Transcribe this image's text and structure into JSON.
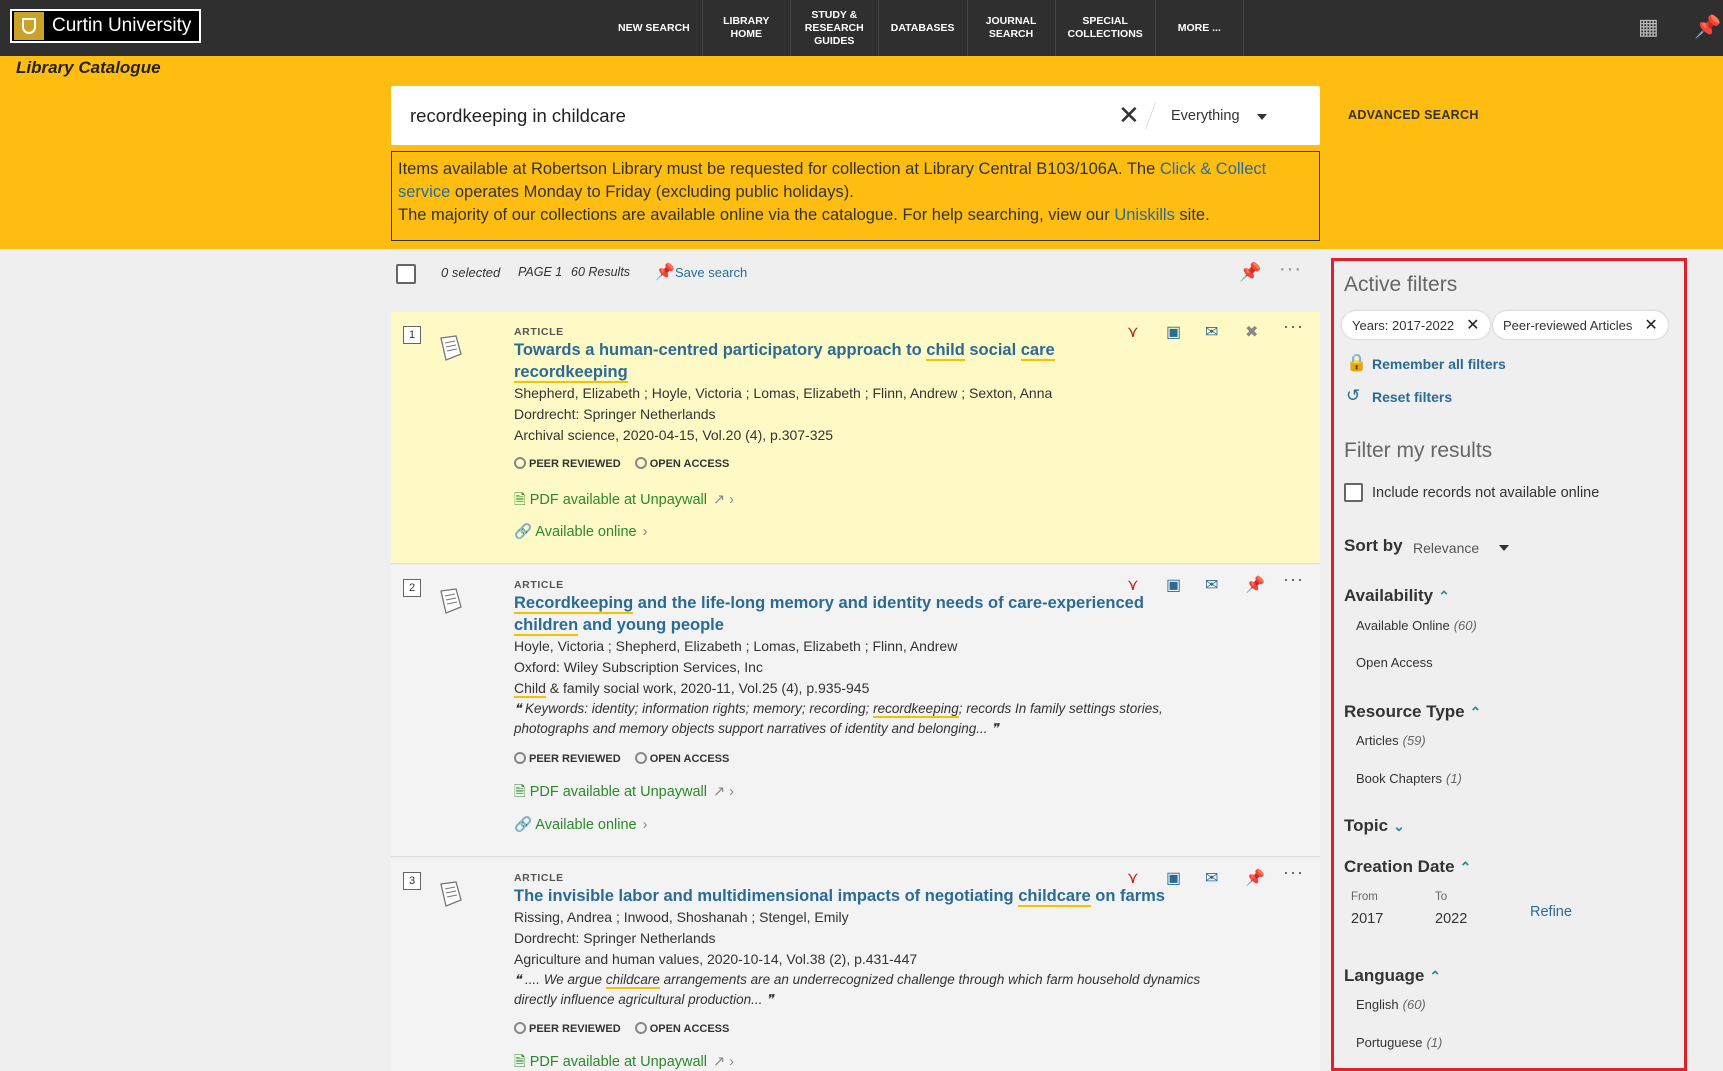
{
  "header": {
    "logo_text": "Curtin University",
    "nav": [
      "NEW SEARCH",
      "LIBRARY\nHOME",
      "STUDY &\nRESEARCH\nGUIDES",
      "DATABASES",
      "JOURNAL\nSEARCH",
      "SPECIAL\nCOLLECTIONS",
      "MORE ..."
    ],
    "site_title": "Library Catalogue"
  },
  "search": {
    "query": "recordkeeping in childcare",
    "scope": "Everything",
    "advanced_label": "ADVANCED SEARCH"
  },
  "notice": {
    "part1": "Items available at Robertson Library must be requested for collection at Library Central B103/106A. The ",
    "link1": "Click & Collect service",
    "part2": " operates Monday to Friday (excluding public holidays).",
    "part3": "The majority of our collections are available online via the catalogue. For help searching, view our ",
    "link2": "Uniskills",
    "part4": " site."
  },
  "toolbar": {
    "selected": "0 selected",
    "page": "PAGE 1",
    "results": "60 Results",
    "save_label": "Save search"
  },
  "results": [
    {
      "num": "1",
      "type": "ARTICLE",
      "title_pre": "Towards a human-centred participatory approach to ",
      "title_hl1": "child",
      "title_mid": " social ",
      "title_hl2": "care",
      "title_post": " ",
      "title_hl3": "recordkeeping",
      "authors": "Shepherd, Elizabeth ; Hoyle, Victoria ; Lomas, Elizabeth ; Flinn, Andrew ; Sexton, Anna",
      "publisher": "Dordrecht: Springer Netherlands",
      "source": "Archival science, 2020-04-15, Vol.20 (4), p.307-325",
      "peer": "PEER REVIEWED",
      "oa": "OPEN ACCESS",
      "pdf": "PDF available at Unpaywall",
      "online": "Available online"
    },
    {
      "num": "2",
      "type": "ARTICLE",
      "title_hl1": "Recordkeeping",
      "title_mid": " and the life-long memory and identity needs of care-experienced ",
      "title_hl2": "children",
      "title_post": " and young people",
      "authors": "Hoyle, Victoria ; Shepherd, Elizabeth ; Lomas, Elizabeth ; Flinn, Andrew",
      "publisher": "Oxford: Wiley Subscription Services, Inc",
      "source_hl": "Child",
      "source": " & family social work, 2020-11, Vol.25 (4), p.935-945",
      "snippet_pre": "Keywords: identity; information rights; memory; recording; ",
      "snippet_hl": "recordkeeping",
      "snippet_post": "; records In family settings stories, photographs and memory objects support narratives of identity and belonging...",
      "peer": "PEER REVIEWED",
      "oa": "OPEN ACCESS",
      "pdf": "PDF available at Unpaywall",
      "online": "Available online"
    },
    {
      "num": "3",
      "type": "ARTICLE",
      "title_pre": "The invisible labor and multidimensional impacts of negotiating ",
      "title_hl1": "childcare",
      "title_post": " on farms",
      "authors": "Rissing, Andrea ; Inwood, Shoshanah ; Stengel, Emily",
      "publisher": "Dordrecht: Springer Netherlands",
      "source": "Agriculture and human values, 2020-10-14, Vol.38 (2), p.431-447",
      "snippet_pre": ".... We argue ",
      "snippet_hl": "childcare",
      "snippet_post": " arrangements are an underrecognized challenge through which farm household dynamics directly influence agricultural production...",
      "peer": "PEER REVIEWED",
      "oa": "OPEN ACCESS",
      "pdf": "PDF available at Unpaywall"
    }
  ],
  "filters": {
    "active_heading": "Active filters",
    "chips": [
      "Years: 2017-2022",
      "Peer-reviewed Articles"
    ],
    "remember": "Remember all filters",
    "reset": "Reset filters",
    "filter_heading": "Filter my results",
    "include_label": "Include records not available online",
    "sort_label": "Sort by",
    "sort_value": "Relevance",
    "availability": {
      "heading": "Availability",
      "items": [
        {
          "label": "Available Online",
          "count": "(60)"
        },
        {
          "label": "Open Access",
          "count": ""
        }
      ]
    },
    "resource_type": {
      "heading": "Resource Type",
      "items": [
        {
          "label": "Articles",
          "count": "(59)"
        },
        {
          "label": "Book Chapters",
          "count": "(1)"
        }
      ]
    },
    "topic": {
      "heading": "Topic"
    },
    "creation_date": {
      "heading": "Creation Date",
      "from_label": "From",
      "to_label": "To",
      "from": "2017",
      "to": "2022",
      "refine": "Refine"
    },
    "language": {
      "heading": "Language",
      "items": [
        {
          "label": "English",
          "count": "(60)"
        },
        {
          "label": "Portuguese",
          "count": "(1)"
        }
      ]
    }
  },
  "colors": {
    "brand_yellow": "#ffbd12",
    "topbar": "#2f2f2f",
    "link": "#2a6b96",
    "available": "#2a8a2a",
    "highlight_border": "#e0202a"
  }
}
